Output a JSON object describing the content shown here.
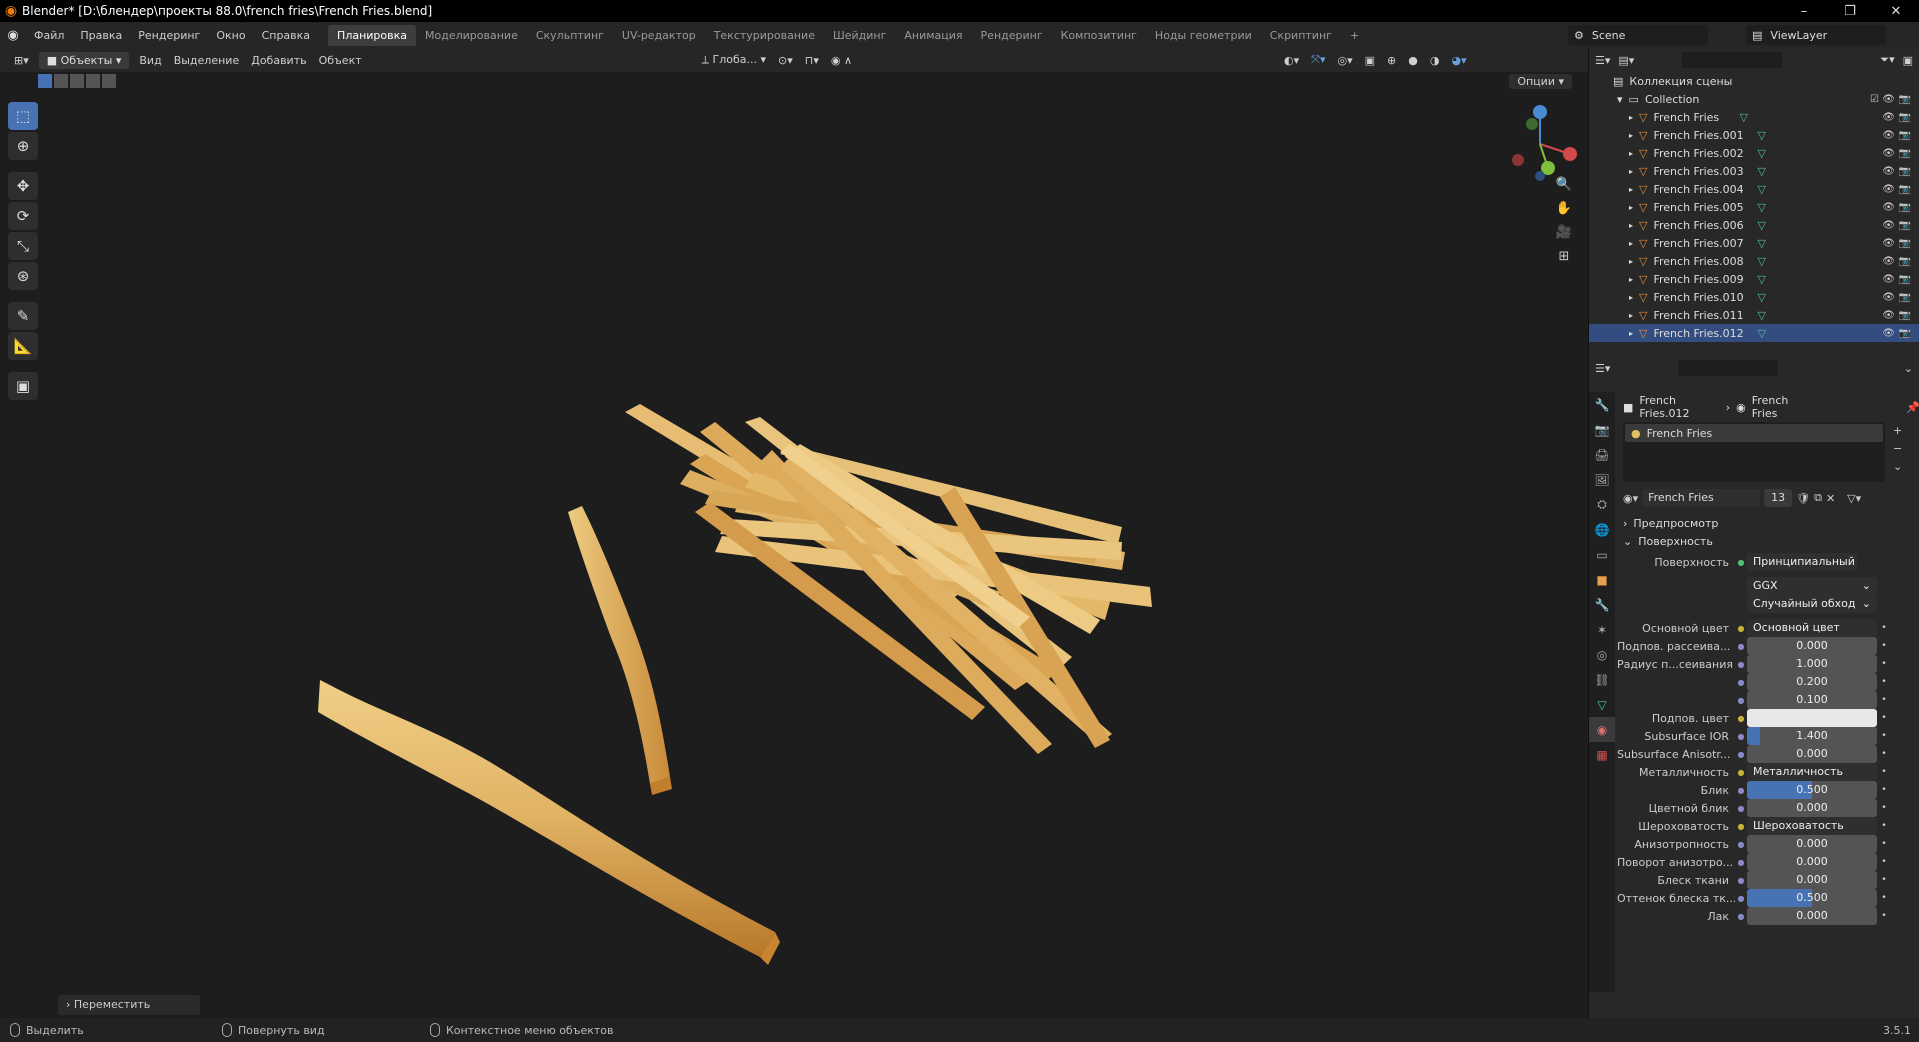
{
  "window": {
    "title": "Blender* [D:\\блендер\\проекты 88.0\\french fries\\French Fries.blend]",
    "min_label": "–",
    "max_label": "❐",
    "close_label": "✕"
  },
  "menu": {
    "items": [
      "Файл",
      "Правка",
      "Рендеринг",
      "Окно",
      "Справка"
    ],
    "workspaces": [
      "Планировка",
      "Моделирование",
      "Скульптинг",
      "UV-редактор",
      "Текстурирование",
      "Шейдинг",
      "Анимация",
      "Рендеринг",
      "Композитинг",
      "Ноды геометрии",
      "Скриптинг"
    ],
    "active_workspace": "Планировка",
    "add_tab": "+",
    "scene": "Scene",
    "view_layer": "ViewLayer"
  },
  "viewport_header": {
    "mode": "Объекты",
    "items": [
      "Вид",
      "Выделение",
      "Добавить",
      "Объект"
    ],
    "transform_orientation": "Глоба...",
    "options_label": "Опции"
  },
  "viewport": {
    "last_op": "Переместить"
  },
  "outliner": {
    "scene_collection": "Коллекция сцены",
    "collection": "Collection",
    "objects": [
      "French Fries",
      "French Fries.001",
      "French Fries.002",
      "French Fries.003",
      "French Fries.004",
      "French Fries.005",
      "French Fries.006",
      "French Fries.007",
      "French Fries.008",
      "French Fries.009",
      "French Fries.010",
      "French Fries.011",
      "French Fries.012"
    ],
    "selected": "French Fries.012"
  },
  "properties": {
    "breadcrumb_object": "French Fries.012",
    "breadcrumb_material": "French Fries",
    "slot_name": "French Fries",
    "material_name": "French Fries",
    "users": "13",
    "preview_label": "Предпросмотр",
    "surface_label": "Поверхность",
    "surface_field": "Поверхность",
    "surface_shader": "Принципиальный BSDF",
    "distribution": "GGX",
    "subsurface_method": "Случайный обход",
    "rows": [
      {
        "label": "Основной цвет",
        "value": "Основной цвет",
        "type": "link"
      },
      {
        "label": "Подпов. рассеива...",
        "value": "0.000",
        "type": "num"
      },
      {
        "label": "Радиус п...сеивания",
        "value": "1.000",
        "type": "num"
      },
      {
        "label": "",
        "value": "0.200",
        "type": "num"
      },
      {
        "label": "",
        "value": "0.100",
        "type": "num"
      },
      {
        "label": "Подпов. цвет",
        "value": "",
        "type": "color"
      },
      {
        "label": "Subsurface IOR",
        "value": "1.400",
        "type": "num",
        "fill": 0.1
      },
      {
        "label": "Subsurface Anisotr...",
        "value": "0.000",
        "type": "num"
      },
      {
        "label": "Металличность",
        "value": "Металличность",
        "type": "link"
      },
      {
        "label": "Блик",
        "value": "0.500",
        "type": "num",
        "fill": 0.5
      },
      {
        "label": "Цветной блик",
        "value": "0.000",
        "type": "num"
      },
      {
        "label": "Шероховатость",
        "value": "Шероховатость",
        "type": "link"
      },
      {
        "label": "Анизотропность",
        "value": "0.000",
        "type": "num"
      },
      {
        "label": "Поворот анизотро...",
        "value": "0.000",
        "type": "num"
      },
      {
        "label": "Блеск ткани",
        "value": "0.000",
        "type": "num"
      },
      {
        "label": "Оттенок блеска тк...",
        "value": "0.500",
        "type": "num",
        "fill": 0.5
      },
      {
        "label": "Лак",
        "value": "0.000",
        "type": "num"
      }
    ]
  },
  "statusbar": {
    "select": "Выделить",
    "rotate": "Повернуть вид",
    "context": "Контекстное меню объектов",
    "version": "3.5.1"
  },
  "colors": {
    "accent": "#4772b3",
    "selected_row": "#334d80",
    "fry_light": "#e8c27a",
    "fry_dark": "#b8782a",
    "blender_orange": "#e87d0d"
  }
}
